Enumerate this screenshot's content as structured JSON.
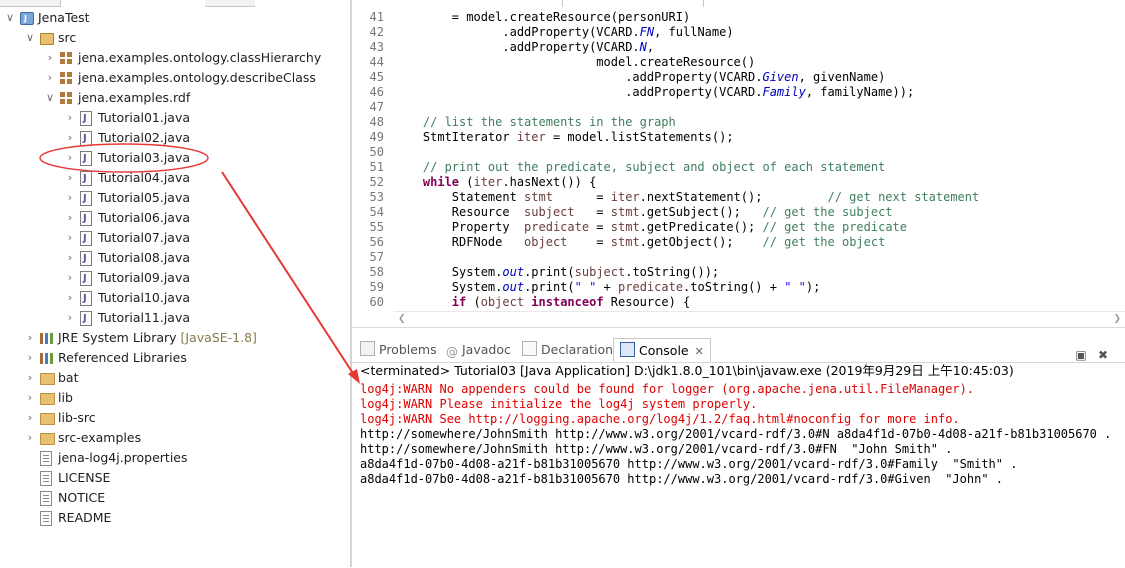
{
  "explorer": {
    "items": [
      {
        "label": "JenaTest",
        "decoration": "",
        "icon": "java-project-icon",
        "expanded": true
      },
      {
        "label": "src",
        "decoration": "",
        "icon": "source-folder-icon",
        "expanded": true
      },
      {
        "label": "jena.examples.ontology.classHierarchy",
        "decoration": "",
        "icon": "package-icon",
        "expanded": false
      },
      {
        "label": "jena.examples.ontology.describeClass",
        "decoration": "",
        "icon": "package-icon",
        "expanded": false
      },
      {
        "label": "jena.examples.rdf",
        "decoration": "",
        "icon": "package-icon",
        "expanded": true
      },
      {
        "label": "Tutorial01.java",
        "decoration": "",
        "icon": "java-file-icon",
        "expanded": false
      },
      {
        "label": "Tutorial02.java",
        "decoration": "",
        "icon": "java-file-icon",
        "expanded": false
      },
      {
        "label": "Tutorial03.java",
        "decoration": "",
        "icon": "java-file-icon",
        "expanded": false
      },
      {
        "label": "Tutorial04.java",
        "decoration": "",
        "icon": "java-file-icon",
        "expanded": false
      },
      {
        "label": "Tutorial05.java",
        "decoration": "",
        "icon": "java-file-icon",
        "expanded": false
      },
      {
        "label": "Tutorial06.java",
        "decoration": "",
        "icon": "java-file-icon",
        "expanded": false
      },
      {
        "label": "Tutorial07.java",
        "decoration": "",
        "icon": "java-file-icon",
        "expanded": false
      },
      {
        "label": "Tutorial08.java",
        "decoration": "",
        "icon": "java-file-icon",
        "expanded": false
      },
      {
        "label": "Tutorial09.java",
        "decoration": "",
        "icon": "java-file-icon",
        "expanded": false
      },
      {
        "label": "Tutorial10.java",
        "decoration": "",
        "icon": "java-file-icon",
        "expanded": false
      },
      {
        "label": "Tutorial11.java",
        "decoration": "",
        "icon": "java-file-icon",
        "expanded": false
      },
      {
        "label": "JRE System Library",
        "decoration": "[JavaSE-1.8]",
        "icon": "library-icon",
        "expanded": false
      },
      {
        "label": "Referenced Libraries",
        "decoration": "",
        "icon": "library-icon",
        "expanded": false
      },
      {
        "label": "bat",
        "decoration": "",
        "icon": "folder-icon",
        "expanded": false
      },
      {
        "label": "lib",
        "decoration": "",
        "icon": "folder-icon",
        "expanded": false
      },
      {
        "label": "lib-src",
        "decoration": "",
        "icon": "folder-icon",
        "expanded": false
      },
      {
        "label": "src-examples",
        "decoration": "",
        "icon": "folder-icon",
        "expanded": false
      },
      {
        "label": "jena-log4j.properties",
        "decoration": "",
        "icon": "file-icon",
        "expanded": false
      },
      {
        "label": "LICENSE",
        "decoration": "",
        "icon": "file-icon",
        "expanded": false
      },
      {
        "label": "NOTICE",
        "decoration": "",
        "icon": "file-icon",
        "expanded": false
      },
      {
        "label": "README",
        "decoration": "",
        "icon": "file-icon",
        "expanded": false
      }
    ],
    "highlighted_item": "Tutorial03.java",
    "annotation_color": "#e53935"
  },
  "editor": {
    "lines": [
      {
        "num": "41",
        "tokens": [
          [
            "",
            "        = model.createResource(personURI)"
          ]
        ]
      },
      {
        "num": "42",
        "tokens": [
          [
            "",
            "               .addProperty(VCARD."
          ],
          [
            "fld",
            "FN"
          ],
          [
            "",
            ", fullName)"
          ]
        ]
      },
      {
        "num": "43",
        "tokens": [
          [
            "",
            "               .addProperty(VCARD."
          ],
          [
            "fld",
            "N"
          ],
          [
            "",
            ","
          ]
        ]
      },
      {
        "num": "44",
        "tokens": [
          [
            "",
            "                            model.createResource()"
          ]
        ]
      },
      {
        "num": "45",
        "tokens": [
          [
            "",
            "                                .addProperty(VCARD."
          ],
          [
            "fld",
            "Given"
          ],
          [
            "",
            ", givenName)"
          ]
        ]
      },
      {
        "num": "46",
        "tokens": [
          [
            "",
            "                                .addProperty(VCARD."
          ],
          [
            "fld",
            "Family"
          ],
          [
            "",
            ", familyName));"
          ]
        ]
      },
      {
        "num": "47",
        "tokens": [
          [
            "",
            ""
          ]
        ]
      },
      {
        "num": "48",
        "tokens": [
          [
            "cm",
            "    // list the statements in the graph"
          ]
        ]
      },
      {
        "num": "49",
        "tokens": [
          [
            "",
            "    StmtIterator "
          ],
          [
            "var",
            "iter"
          ],
          [
            "",
            " = model.listStatements();"
          ]
        ]
      },
      {
        "num": "50",
        "tokens": [
          [
            "",
            ""
          ]
        ]
      },
      {
        "num": "51",
        "tokens": [
          [
            "cm",
            "    // print out the predicate, subject and object of each statement"
          ]
        ]
      },
      {
        "num": "52",
        "tokens": [
          [
            "kw",
            "    while"
          ],
          [
            "",
            " ("
          ],
          [
            "var",
            "iter"
          ],
          [
            "",
            ".hasNext()) {"
          ]
        ]
      },
      {
        "num": "53",
        "tokens": [
          [
            "",
            "        Statement "
          ],
          [
            "var",
            "stmt"
          ],
          [
            "",
            "      = "
          ],
          [
            "var",
            "iter"
          ],
          [
            "",
            ".nextStatement();         "
          ],
          [
            "cm",
            "// get next statement"
          ]
        ]
      },
      {
        "num": "54",
        "tokens": [
          [
            "",
            "        Resource  "
          ],
          [
            "var",
            "subject"
          ],
          [
            "",
            "   = "
          ],
          [
            "var",
            "stmt"
          ],
          [
            "",
            ".getSubject();   "
          ],
          [
            "cm",
            "// get the subject"
          ]
        ]
      },
      {
        "num": "55",
        "tokens": [
          [
            "",
            "        Property  "
          ],
          [
            "var",
            "predicate"
          ],
          [
            "",
            " = "
          ],
          [
            "var",
            "stmt"
          ],
          [
            "",
            ".getPredicate(); "
          ],
          [
            "cm",
            "// get the predicate"
          ]
        ]
      },
      {
        "num": "56",
        "tokens": [
          [
            "",
            "        RDFNode   "
          ],
          [
            "var",
            "object"
          ],
          [
            "",
            "    = "
          ],
          [
            "var",
            "stmt"
          ],
          [
            "",
            ".getObject();    "
          ],
          [
            "cm",
            "// get the object"
          ]
        ]
      },
      {
        "num": "57",
        "tokens": [
          [
            "",
            ""
          ]
        ]
      },
      {
        "num": "58",
        "tokens": [
          [
            "",
            "        System."
          ],
          [
            "fld",
            "out"
          ],
          [
            "",
            ".print("
          ],
          [
            "var",
            "subject"
          ],
          [
            "",
            ".toString());"
          ]
        ]
      },
      {
        "num": "59",
        "tokens": [
          [
            "",
            "        System."
          ],
          [
            "fld",
            "out"
          ],
          [
            "",
            ".print("
          ],
          [
            "str",
            "\" \""
          ],
          [
            "",
            " + "
          ],
          [
            "var",
            "predicate"
          ],
          [
            "",
            ".toString() + "
          ],
          [
            "str",
            "\" \""
          ],
          [
            "",
            ");"
          ]
        ]
      },
      {
        "num": "60",
        "tokens": [
          [
            "kw",
            "        if"
          ],
          [
            "",
            " ("
          ],
          [
            "var",
            "object"
          ],
          [
            "",
            " "
          ],
          [
            "kw",
            "instanceof"
          ],
          [
            "",
            " Resource) {"
          ]
        ]
      }
    ]
  },
  "console": {
    "tabs": [
      {
        "label": "Problems",
        "icon": "problems-icon",
        "active": false
      },
      {
        "label": "Javadoc",
        "icon": "javadoc-at-icon",
        "active": false
      },
      {
        "label": "Declaration",
        "icon": "declaration-icon",
        "active": false
      },
      {
        "label": "Console",
        "icon": "console-icon",
        "active": true
      }
    ],
    "close_glyph": "✕",
    "minimize_glyph": "▣",
    "maximize_glyph": "✖",
    "status": "<terminated> Tutorial03 [Java Application] D:\\jdk1.8.0_101\\bin\\javaw.exe (2019年9月29日 上午10:45:03)",
    "output": [
      {
        "type": "err",
        "text": "log4j:WARN No appenders could be found for logger (org.apache.jena.util.FileManager)."
      },
      {
        "type": "err",
        "text": "log4j:WARN Please initialize the log4j system properly."
      },
      {
        "type": "err",
        "text": "log4j:WARN See http://logging.apache.org/log4j/1.2/faq.html#noconfig for more info."
      },
      {
        "type": "std",
        "text": "http://somewhere/JohnSmith http://www.w3.org/2001/vcard-rdf/3.0#N a8da4f1d-07b0-4d08-a21f-b81b31005670 ."
      },
      {
        "type": "std",
        "text": "http://somewhere/JohnSmith http://www.w3.org/2001/vcard-rdf/3.0#FN  \"John Smith\" ."
      },
      {
        "type": "std",
        "text": "a8da4f1d-07b0-4d08-a21f-b81b31005670 http://www.w3.org/2001/vcard-rdf/3.0#Family  \"Smith\" ."
      },
      {
        "type": "std",
        "text": "a8da4f1d-07b0-4d08-a21f-b81b31005670 http://www.w3.org/2001/vcard-rdf/3.0#Given  \"John\" ."
      }
    ]
  },
  "colors": {
    "error_text": "#e00000",
    "keyword": "#7f0055",
    "comment": "#3f7f5f",
    "field": "#0000c0"
  }
}
